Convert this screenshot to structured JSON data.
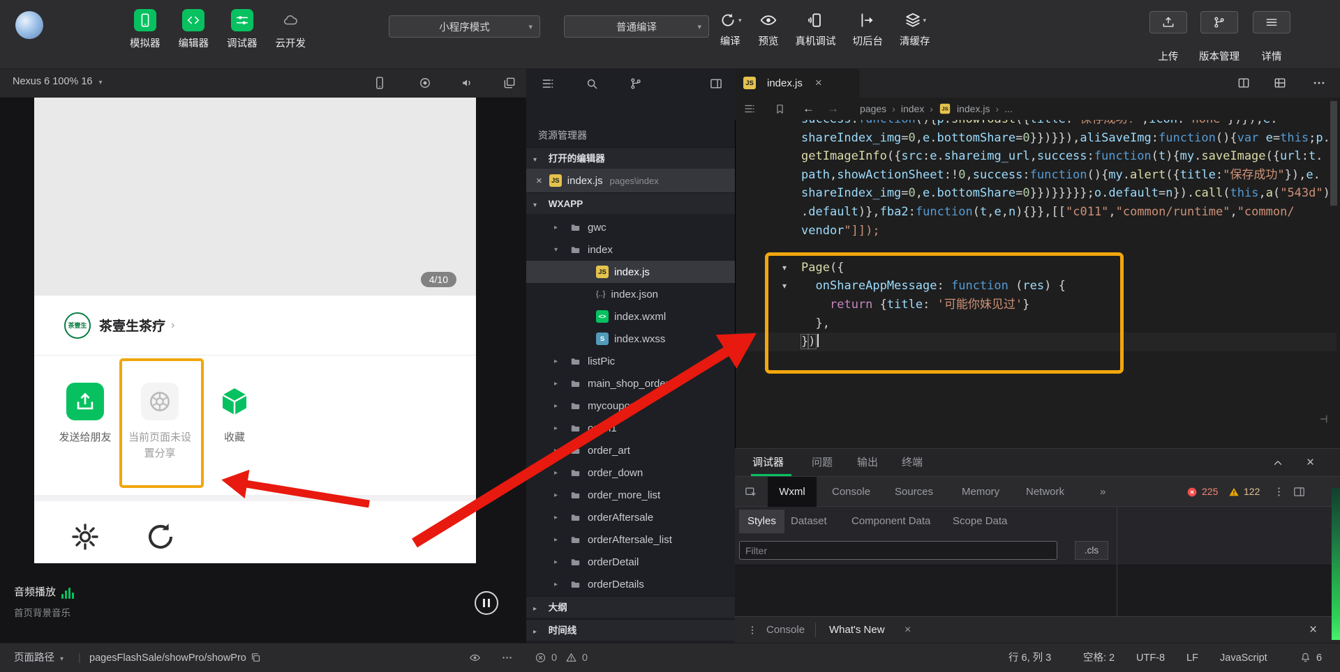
{
  "toolbar": {
    "mode_select": "小程序模式",
    "compile_select": "普通编译",
    "left_tools": [
      {
        "label": "模拟器"
      },
      {
        "label": "编辑器"
      },
      {
        "label": "调试器"
      },
      {
        "label": "云开发"
      }
    ],
    "actions": [
      {
        "label": "编译"
      },
      {
        "label": "预览"
      },
      {
        "label": "真机调试"
      },
      {
        "label": "切后台"
      },
      {
        "label": "清缓存"
      }
    ],
    "right_tools": [
      {
        "label": "上传"
      },
      {
        "label": "版本管理"
      },
      {
        "label": "详情"
      }
    ]
  },
  "simulator": {
    "device_label": "Nexus 6 100% 16",
    "page_badge": "4/10",
    "share": {
      "brand": "茶壹生茶疗",
      "logo_text": "茶壹生",
      "item1": "发送给朋友",
      "item2_line1": "当前页面未设",
      "item2_line2": "置分享",
      "item3": "收藏"
    },
    "audio_title": "音频播放",
    "audio_subtitle": "首页背景音乐"
  },
  "explorer": {
    "title": "资源管理器",
    "open_editors_header": "打开的编辑器",
    "open_file": "index.js",
    "open_file_path": "pages\\index",
    "project_header": "WXAPP",
    "outline_header": "大纲",
    "timeline_header": "时间线",
    "tree": [
      {
        "name": "gwc",
        "type": "folder",
        "expanded": false
      },
      {
        "name": "index",
        "type": "folder",
        "expanded": true
      },
      {
        "name": "index.js",
        "type": "js",
        "selected": true
      },
      {
        "name": "index.json",
        "type": "json"
      },
      {
        "name": "index.wxml",
        "type": "wxml"
      },
      {
        "name": "index.wxss",
        "type": "wxss"
      },
      {
        "name": "listPic",
        "type": "folder",
        "expanded": false
      },
      {
        "name": "main_shop_order",
        "type": "folder",
        "expanded": false
      },
      {
        "name": "mycoupon",
        "type": "folder",
        "expanded": false
      },
      {
        "name": "open1",
        "type": "folder",
        "expanded": false
      },
      {
        "name": "order_art",
        "type": "folder",
        "expanded": false
      },
      {
        "name": "order_down",
        "type": "folder",
        "expanded": false
      },
      {
        "name": "order_more_list",
        "type": "folder",
        "expanded": false
      },
      {
        "name": "orderAftersale",
        "type": "folder",
        "expanded": false
      },
      {
        "name": "orderAftersale_list",
        "type": "folder",
        "expanded": false
      },
      {
        "name": "orderDetail",
        "type": "folder",
        "expanded": false
      },
      {
        "name": "orderDetails",
        "type": "folder",
        "expanded": false
      }
    ]
  },
  "editor": {
    "tab_label": "index.js",
    "breadcrumb": [
      "pages",
      "index",
      "index.js",
      "..."
    ],
    "code_lines": [
      "success:function(){p.showToast({title:'保存成功!',icon:'none'})}),e.",
      "shareIndex_img=0,e.bottomShare=0}})}}),aliSaveImg:function(){var e=this;p.",
      "getImageInfo({src:e.shareimg_url,success:function(t){my.saveImage({url:t.",
      "path,showActionSheet:!0,success:function(){my.alert({title:\"保存成功\"}),e.",
      "shareIndex_img=0,e.bottomShare=0}})}}}}};o.default=n}).call(this,a(\"543d\")",
      ".default)},fba2:function(t,e,n){}},[[\"c011\",\"common/runtime\",\"common/",
      "vendor\"]]);",
      "",
      "Page({",
      "  onShareAppMessage: function (res) {",
      "    return {title: '可能你妹见过'}",
      "  },",
      "})"
    ],
    "fold_lines": [
      8,
      9
    ],
    "cursor_line": 12
  },
  "debugger": {
    "tabs": [
      "调试器",
      "问题",
      "输出",
      "终端"
    ],
    "devtools_tabs": [
      "Wxml",
      "Console",
      "Sources",
      "Memory",
      "Network"
    ],
    "overflow_glyph": "»",
    "error_count": "225",
    "warning_count": "122",
    "inspector_tabs": [
      "Styles",
      "Dataset",
      "Component Data",
      "Scope Data"
    ],
    "filter_placeholder": "Filter",
    "cls_label": ".cls",
    "drawer": {
      "console": "Console",
      "whats_new": "What's New"
    }
  },
  "statusbar": {
    "path_label": "页面路径",
    "path_value": "pagesFlashSale/showPro/showPro",
    "errors": "0",
    "warnings": "0",
    "line_col": "行 6, 列 3",
    "spaces": "空格: 2",
    "encoding": "UTF-8",
    "eol": "LF",
    "language": "JavaScript",
    "notification_count": "6"
  },
  "colors": {
    "wechat_green": "#07c160",
    "highlight_orange": "#f2a60d",
    "arrow_red": "#e8190f"
  }
}
